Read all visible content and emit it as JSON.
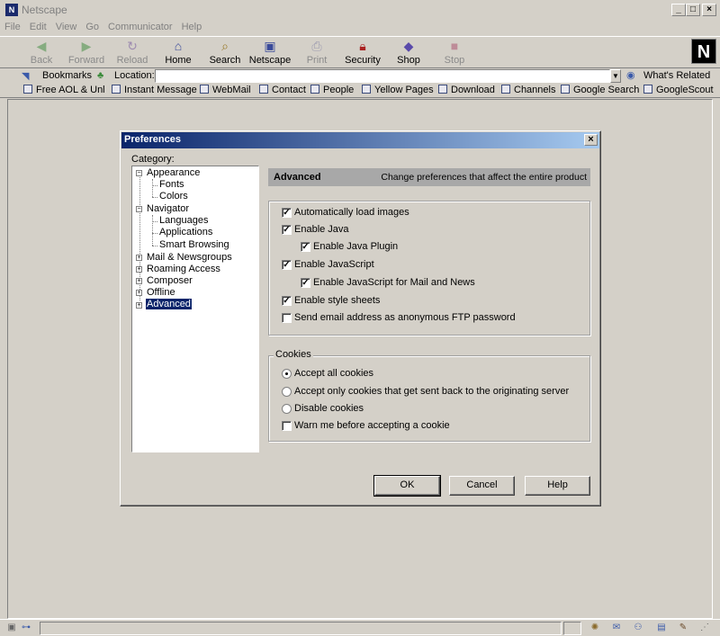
{
  "window": {
    "title": "Netscape"
  },
  "menu": [
    "File",
    "Edit",
    "View",
    "Go",
    "Communicator",
    "Help"
  ],
  "toolbar": {
    "buttons": [
      {
        "label": "Back",
        "icon": "back-arrow-icon",
        "disabled": true
      },
      {
        "label": "Forward",
        "icon": "forward-arrow-icon",
        "disabled": true
      },
      {
        "label": "Reload",
        "icon": "reload-icon",
        "disabled": true
      },
      {
        "label": "Home",
        "icon": "home-icon",
        "disabled": false
      },
      {
        "label": "Search",
        "icon": "search-icon",
        "disabled": false
      },
      {
        "label": "Netscape",
        "icon": "netscape-icon",
        "disabled": false
      },
      {
        "label": "Print",
        "icon": "print-icon",
        "disabled": true
      },
      {
        "label": "Security",
        "icon": "security-lock-icon",
        "disabled": false
      },
      {
        "label": "Shop",
        "icon": "shop-icon",
        "disabled": false
      },
      {
        "label": "Stop",
        "icon": "stop-icon",
        "disabled": true
      }
    ]
  },
  "location": {
    "bookmarks_label": "Bookmarks",
    "label": "Location:",
    "value": "",
    "whats_related": "What's Related"
  },
  "personal_toolbar": [
    "Free AOL & Unl",
    "Instant Message",
    "WebMail",
    "Contact",
    "People",
    "Yellow Pages",
    "Download",
    "Channels",
    "Google Search",
    "GoogleScout"
  ],
  "dialog": {
    "title": "Preferences",
    "category_label": "Category:",
    "tree": {
      "appearance": "Appearance",
      "fonts": "Fonts",
      "colors": "Colors",
      "navigator": "Navigator",
      "languages": "Languages",
      "applications": "Applications",
      "smart_browsing": "Smart Browsing",
      "mail": "Mail & Newsgroups",
      "roaming": "Roaming Access",
      "composer": "Composer",
      "offline": "Offline",
      "advanced": "Advanced"
    },
    "panel_title": "Advanced",
    "panel_desc": "Change preferences that affect the entire product",
    "options": {
      "auto_images": "Automatically load images",
      "enable_java": "Enable Java",
      "java_plugin": "Enable Java Plugin",
      "enable_js": "Enable JavaScript",
      "js_mail": "Enable JavaScript for Mail and News",
      "style_sheets": "Enable style sheets",
      "ftp_email": "Send email address as anonymous FTP password"
    },
    "cookies": {
      "legend": "Cookies",
      "accept_all": "Accept all cookies",
      "accept_origin": "Accept only cookies that get sent back to the originating server",
      "disable": "Disable cookies",
      "warn": "Warn me before accepting a cookie"
    },
    "buttons": {
      "ok": "OK",
      "cancel": "Cancel",
      "help": "Help"
    }
  }
}
